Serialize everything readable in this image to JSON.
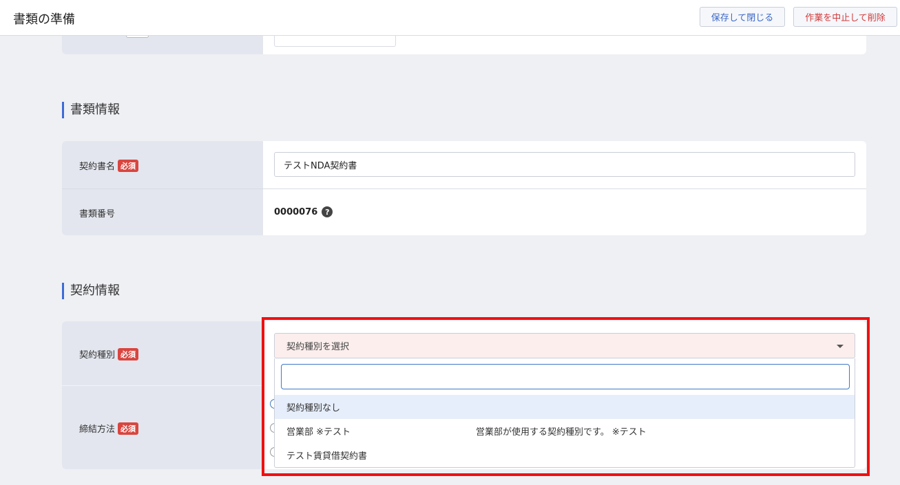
{
  "header": {
    "title": "書類の準備",
    "save_close_label": "保存して閉じる",
    "abort_delete_label": "作業を中止して削除"
  },
  "document_info": {
    "section_title": "書類情報",
    "contract_name": {
      "label": "契約書名",
      "required_badge": "必須",
      "value": "テストNDA契約書"
    },
    "document_number": {
      "label": "書類番号",
      "value": "0000076",
      "help_icon": "?"
    }
  },
  "contract_info": {
    "section_title": "契約情報",
    "contract_type": {
      "label": "契約種別",
      "required_badge": "必須",
      "placeholder": "契約種別を選択",
      "search_value": "",
      "options": [
        {
          "name": "契約種別なし",
          "description": ""
        },
        {
          "name": "営業部 ※テスト",
          "description": "営業部が使用する契約種別です。 ※テスト"
        },
        {
          "name": "テスト賃貸借契約書",
          "description": ""
        }
      ]
    },
    "conclusion_method": {
      "label": "締結方法",
      "required_badge": "必須"
    }
  },
  "colors": {
    "accent": "#3d6bd6",
    "required": "#d9453f",
    "highlight_frame": "#f01010",
    "select_bg": "#fbeeed",
    "active_option": "#e6eefb"
  },
  "icons": [
    "help-icon",
    "chevron-down-icon"
  ]
}
